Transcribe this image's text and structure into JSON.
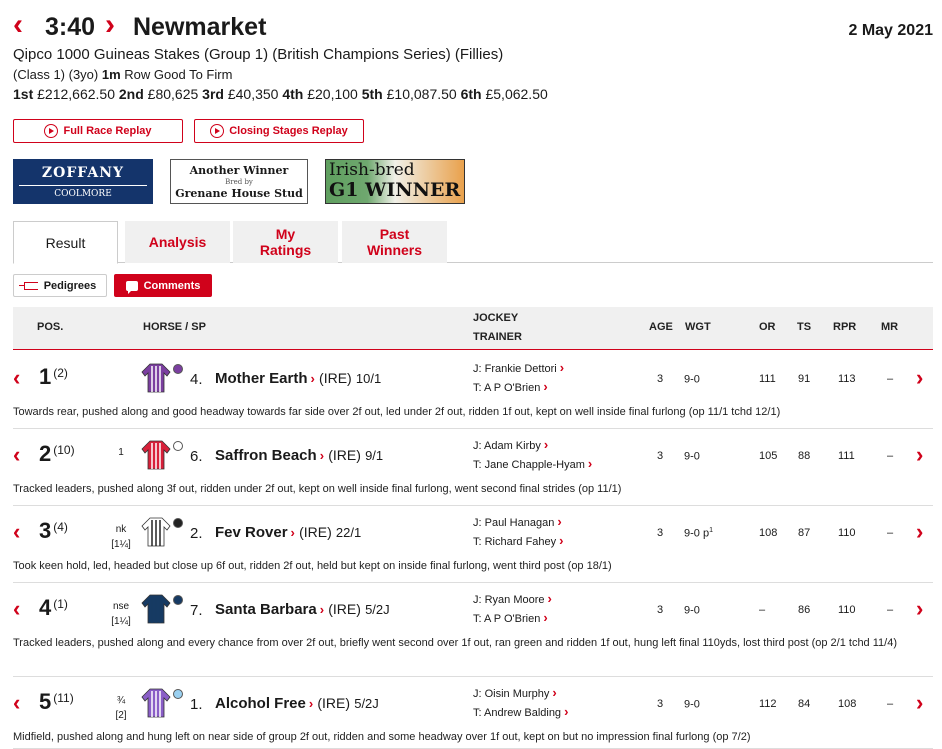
{
  "header": {
    "time": "3:40",
    "course": "Newmarket",
    "date": "2 May 2021",
    "prev_icon": "chevron-left-icon",
    "next_icon": "chevron-right-icon"
  },
  "race": {
    "title": "Qipco 1000 Guineas Stakes (Group 1) (British Champions Series) (Fillies)",
    "class_age": "(Class 1) (3yo)",
    "distance": "1m",
    "going": "Row Good To Firm",
    "prizes": [
      {
        "place": "1st",
        "amount": "£212,662.50"
      },
      {
        "place": "2nd",
        "amount": "£80,625"
      },
      {
        "place": "3rd",
        "amount": "£40,350"
      },
      {
        "place": "4th",
        "amount": "£20,100"
      },
      {
        "place": "5th",
        "amount": "£10,087.50"
      },
      {
        "place": "6th",
        "amount": "£5,062.50"
      }
    ]
  },
  "buttons": {
    "full_replay": "Full Race Replay",
    "closing_replay": "Closing Stages Replay"
  },
  "ads": {
    "zoffany_title": "ZOFFANY",
    "zoffany_sub": "COOLMORE",
    "winner_line1": "Another Winner",
    "winner_line2": "Bred by",
    "winner_line3": "Grenane House Stud",
    "irish_line1": "Irish-bred",
    "irish_line2": "G1 WINNER"
  },
  "tabs": [
    "Result",
    "Analysis",
    "My Ratings",
    "Past Winners"
  ],
  "pills": {
    "pedigrees": "Pedigrees",
    "comments": "Comments"
  },
  "columns": {
    "pos": "POS.",
    "horse": "HORSE / SP",
    "jockey": "JOCKEY",
    "trainer": "TRAINER",
    "age": "AGE",
    "wgt": "WGT",
    "or": "OR",
    "ts": "TS",
    "rpr": "RPR",
    "mr": "MR"
  },
  "colors": {
    "accent": "#d0021b"
  },
  "runners": [
    {
      "pos": "1",
      "draw": "(2)",
      "dist1": "",
      "dist2": "",
      "num": "4.",
      "name": "Mother Earth",
      "origin": "(IRE)",
      "sp": "10/1",
      "jockey": "J: Frankie Dettori",
      "trainer": "T: A P O'Brien",
      "age": "3",
      "wgt": "9-0",
      "wgt_sup": "",
      "or": "111",
      "ts": "91",
      "rpr": "113",
      "mr": "–",
      "comment": "Towards rear, pushed along and good headway towards far side over 2f out, led under 2f out, ridden 1f out, kept on well inside final furlong (op 11/1 tchd 12/1)"
    },
    {
      "pos": "2",
      "draw": "(10)",
      "dist1": "1",
      "dist2": "",
      "num": "6.",
      "name": "Saffron Beach",
      "origin": "(IRE)",
      "sp": "9/1",
      "jockey": "J: Adam Kirby",
      "trainer": "T: Jane Chapple-Hyam",
      "age": "3",
      "wgt": "9-0",
      "wgt_sup": "",
      "or": "105",
      "ts": "88",
      "rpr": "111",
      "mr": "–",
      "comment": "Tracked leaders, pushed along 3f out, ridden under 2f out, kept on well inside final furlong, went second final strides (op 11/1)"
    },
    {
      "pos": "3",
      "draw": "(4)",
      "dist1": "nk",
      "dist2": "[1¼]",
      "num": "2.",
      "name": "Fev Rover",
      "origin": "(IRE)",
      "sp": "22/1",
      "jockey": "J: Paul Hanagan",
      "trainer": "T: Richard Fahey",
      "age": "3",
      "wgt": "9-0 p",
      "wgt_sup": "1",
      "or": "108",
      "ts": "87",
      "rpr": "110",
      "mr": "–",
      "comment": "Took keen hold, led, headed but close up 6f out, ridden 2f out, held but kept on inside final furlong, went third post (op 18/1)"
    },
    {
      "pos": "4",
      "draw": "(1)",
      "dist1": "nse",
      "dist2": "[1¼]",
      "num": "7.",
      "name": "Santa Barbara",
      "origin": "(IRE)",
      "sp": "5/2J",
      "jockey": "J: Ryan Moore",
      "trainer": "T: A P O'Brien",
      "age": "3",
      "wgt": "9-0",
      "wgt_sup": "",
      "or": "–",
      "ts": "86",
      "rpr": "110",
      "mr": "–",
      "comment": "Tracked leaders, pushed along and every chance from over 2f out, briefly went second over 1f out, ran green and ridden 1f out, hung left final 110yds, lost third post (op 2/1 tchd 11/4)"
    },
    {
      "pos": "5",
      "draw": "(11)",
      "dist1": "¾",
      "dist2": "[2]",
      "num": "1.",
      "name": "Alcohol Free",
      "origin": "(IRE)",
      "sp": "5/2J",
      "jockey": "J: Oisin Murphy",
      "trainer": "T: Andrew Balding",
      "age": "3",
      "wgt": "9-0",
      "wgt_sup": "",
      "or": "112",
      "ts": "84",
      "rpr": "108",
      "mr": "–",
      "comment": "Midfield, pushed along and hung left on near side of group 2f out, ridden and some headway over 1f out, kept on but no impression final furlong (op 7/2)"
    }
  ]
}
